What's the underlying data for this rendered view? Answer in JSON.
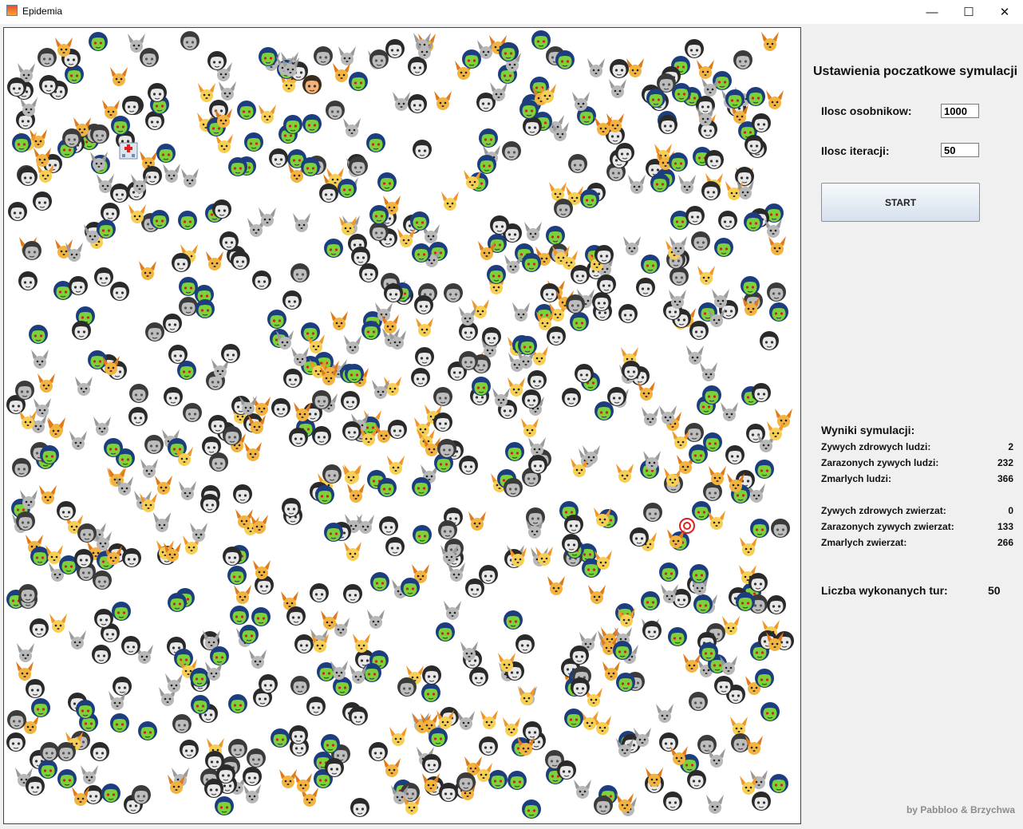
{
  "window": {
    "title": "Epidemia",
    "controls": {
      "minimize": "—",
      "maximize": "☐",
      "close": "✕"
    }
  },
  "icons": {
    "app": "java-app-icon",
    "sprites": [
      "healthy-person-icon",
      "infected-person-icon",
      "dead-person-icon",
      "healthy-animal-icon",
      "infected-animal-icon",
      "dead-animal-icon",
      "hospital-icon",
      "doctor-icon",
      "target-icon"
    ]
  },
  "settings": {
    "title": "Ustawienia poczatkowe symulacji",
    "population_label": "Ilosc osobnikow:",
    "population_value": "1000",
    "iterations_label": "Ilosc iteracji:",
    "iterations_value": "50",
    "start_label": "START"
  },
  "results": {
    "heading": "Wyniki symulacji:",
    "rows": [
      {
        "label": "Zywych zdrowych ludzi:",
        "value": "2"
      },
      {
        "label": "Zarazonych zywych ludzi:",
        "value": "232"
      },
      {
        "label": "Zmarlych ludzi:",
        "value": "366"
      },
      {
        "label": "Zywych zdrowych zwierzat:",
        "value": "0"
      },
      {
        "label": "Zarazonych zywych zwierzat:",
        "value": "133"
      },
      {
        "label": "Zmarlych zwierzat:",
        "value": "266"
      }
    ]
  },
  "turns": {
    "label": "Liczba wykonanych tur:",
    "value": "50"
  },
  "footer": "by Pabbloo & Brzychwa",
  "colors": {
    "infected_skin": "#7bd23a",
    "infected_hair": "#1d3e7e",
    "dead_grey": "#8a8a8a",
    "animal_orange": "#f0962a",
    "animal_face": "#f7cf55",
    "panel_bg": "#f0f0f0"
  }
}
